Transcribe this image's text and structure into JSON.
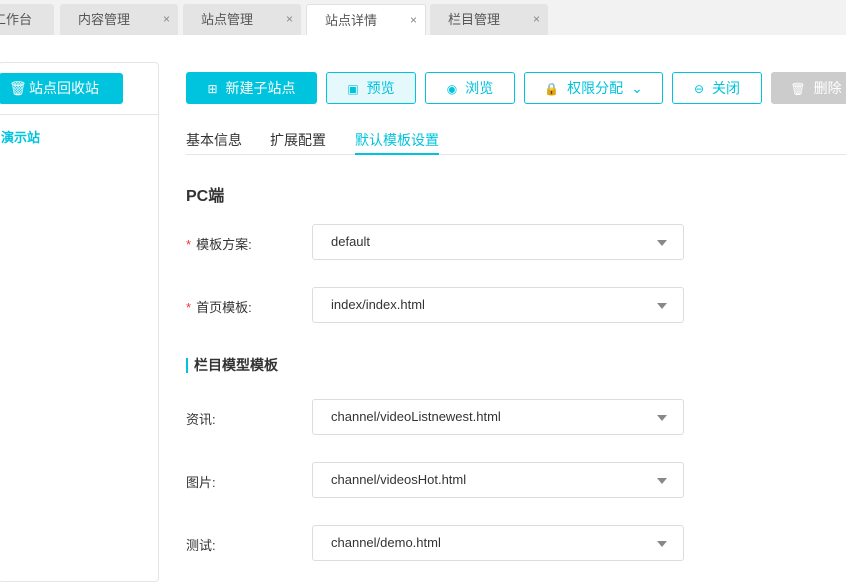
{
  "tabs": [
    {
      "label": "工作台"
    },
    {
      "label": "内容管理"
    },
    {
      "label": "站点管理"
    },
    {
      "label": "站点详情"
    },
    {
      "label": "栏目管理"
    }
  ],
  "close_glyph": "×",
  "sidebar": {
    "recycle_label": "站点回收站",
    "site_label": "演示站"
  },
  "toolbar": {
    "new_sub": "新建子站点",
    "preview": "预览",
    "browse": "浏览",
    "perm": "权限分配",
    "close": "关闭",
    "delete": "删除"
  },
  "subtabs": [
    "基本信息",
    "扩展配置",
    "默认模板设置"
  ],
  "form": {
    "pc_title": "PC端",
    "required_mark": "*",
    "scheme_label": "模板方案:",
    "scheme_value": "default",
    "home_label": "首页模板:",
    "home_value": "index/index.html",
    "section_title": "栏目模型模板",
    "channels": [
      {
        "label": "资讯:",
        "value": "channel/videoListnewest.html"
      },
      {
        "label": "图片:",
        "value": "channel/videosHot.html"
      },
      {
        "label": "测试:",
        "value": "channel/demo.html"
      }
    ]
  },
  "colors": {
    "accent": "#00c4de"
  }
}
